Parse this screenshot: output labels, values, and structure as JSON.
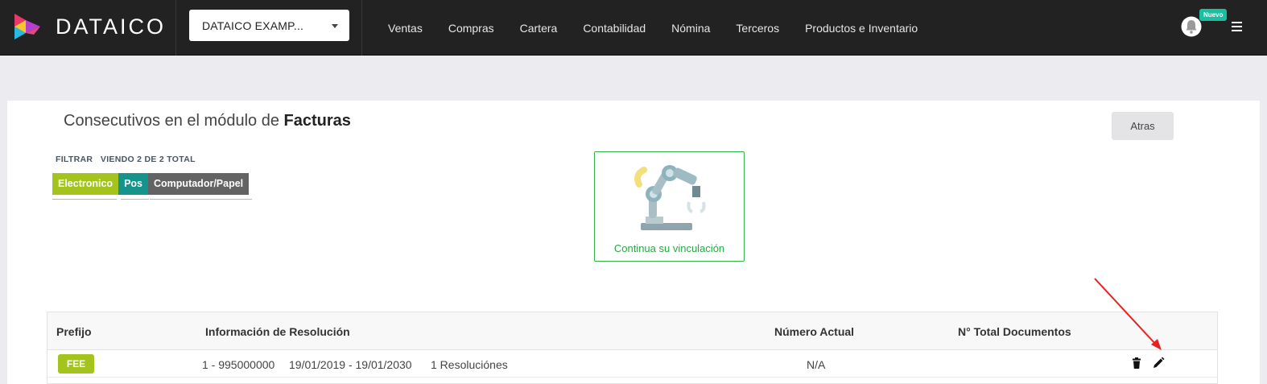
{
  "header": {
    "brand": "DATAICO",
    "company_selector": "DATAICO EXAMP...",
    "nav": [
      "Ventas",
      "Compras",
      "Cartera",
      "Contabilidad",
      "Nómina",
      "Terceros",
      "Productos e Inventario"
    ],
    "notification_badge": "Nuevo"
  },
  "page": {
    "title_prefix": "Consecutivos en el módulo de",
    "title_module": "Facturas",
    "back_label": "Atras"
  },
  "filter": {
    "label": "FILTRAR",
    "count_text": "VIENDO 2 DE 2 TOTAL",
    "chips": [
      "Electronico",
      "Pos",
      "Computador/Papel"
    ]
  },
  "promo": {
    "text": "Continua su vinculación"
  },
  "table": {
    "columns": [
      "Prefijo",
      "Información de Resolución",
      "Número Actual",
      "N° Total Documentos"
    ],
    "rows": [
      {
        "prefix": "FEE",
        "range": "1 - 995000000",
        "dates": "19/01/2019 - 19/01/2030",
        "resolutions": "1 Resoluciónes",
        "current_number": "N/A",
        "total_documents": ""
      }
    ]
  },
  "colors": {
    "topbar": "#222222",
    "chip_electronico": "#a4c31d",
    "chip_pos": "#16948c",
    "chip_papel": "#636363",
    "promo_green": "#27a844",
    "badge_teal": "#1bbfa0",
    "annotation_arrow": "#e82020"
  },
  "icons": [
    "dataico-logo-icon",
    "chevron-down-icon",
    "bell-icon",
    "hamburger-menu-icon",
    "robot-arm-illustration",
    "trash-icon",
    "pencil-icon"
  ]
}
